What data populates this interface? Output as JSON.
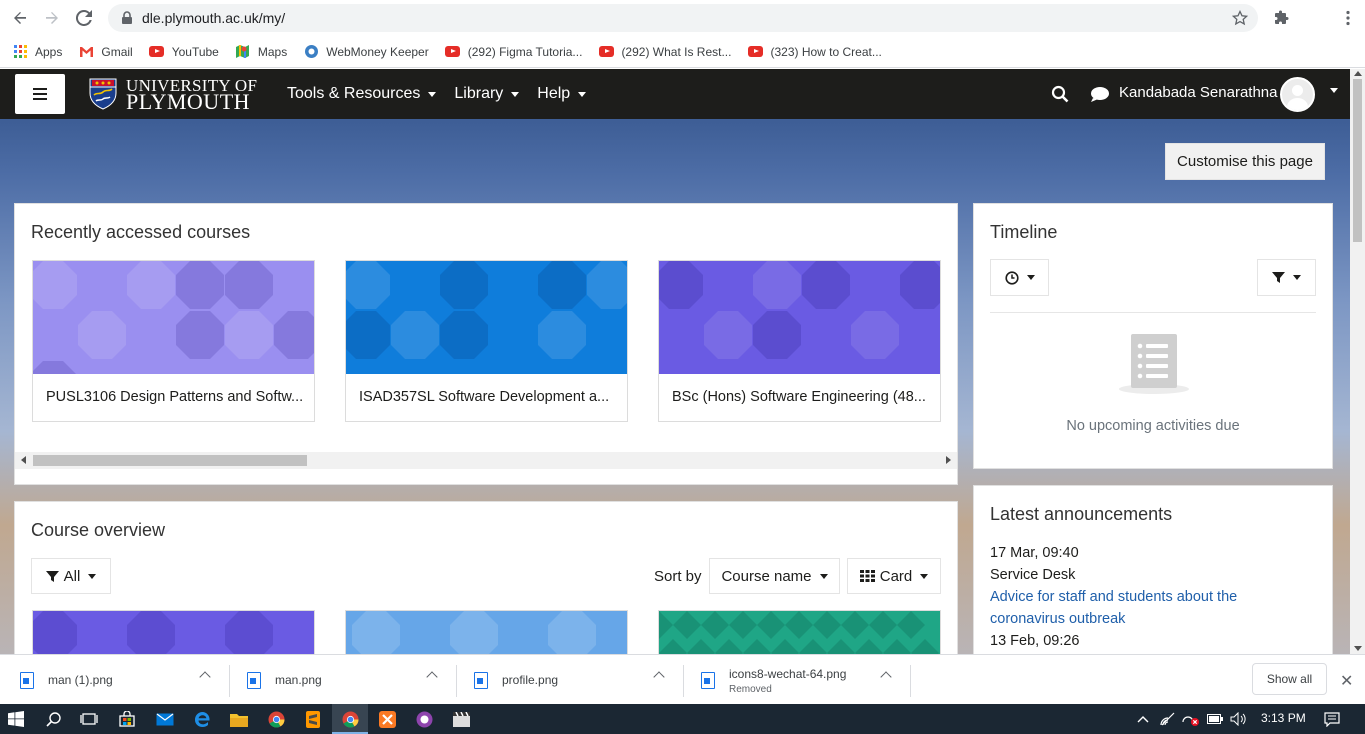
{
  "browser": {
    "url": "dle.plymouth.ac.uk/my/",
    "bookmarks": [
      {
        "label": "Apps",
        "icon": "apps-grid-icon"
      },
      {
        "label": "Gmail",
        "icon": "gmail-icon"
      },
      {
        "label": "YouTube",
        "icon": "youtube-icon"
      },
      {
        "label": "Maps",
        "icon": "maps-icon"
      },
      {
        "label": "WebMoney Keeper",
        "icon": "webmoney-icon"
      },
      {
        "label": "(292) Figma Tutoria...",
        "icon": "youtube-icon"
      },
      {
        "label": "(292) What Is Rest...",
        "icon": "youtube-icon"
      },
      {
        "label": "(323) How to Creat...",
        "icon": "youtube-icon"
      }
    ]
  },
  "navbar": {
    "logo_line1": "UNIVERSITY OF",
    "logo_line2": "PLYMOUTH",
    "menu": [
      "Tools & Resources",
      "Library",
      "Help"
    ],
    "user_name": "Kandabada Senarathna"
  },
  "page": {
    "customise_label": "Customise this page"
  },
  "recent": {
    "title": "Recently accessed courses",
    "courses": [
      {
        "name": "PUSL3106 Design Patterns and Softw...",
        "color": "#9a8ff0"
      },
      {
        "name": "ISAD357SL Software Development a...",
        "color": "#0f7ddb"
      },
      {
        "name": "BSc (Hons) Software Engineering (48...",
        "color": "#6a5be3"
      }
    ]
  },
  "timeline": {
    "title": "Timeline",
    "empty_text": "No upcoming activities due"
  },
  "overview": {
    "title": "Course overview",
    "filter_label": "All",
    "sort_label": "Sort by",
    "sort_value": "Course name",
    "view_value": "Card",
    "tiles": [
      "#6a5be3",
      "#66a6e8",
      "#1fa686"
    ]
  },
  "announcements": {
    "title": "Latest announcements",
    "items": [
      {
        "date": "17 Mar, 09:40",
        "author": "Service Desk",
        "link_line1": "Advice for staff and students about the",
        "link_line2": "coronavirus outbreak"
      },
      {
        "date": "13 Feb, 09:26"
      }
    ]
  },
  "downloads": {
    "items": [
      {
        "name": "man (1).png",
        "status": ""
      },
      {
        "name": "man.png",
        "status": ""
      },
      {
        "name": "profile.png",
        "status": ""
      },
      {
        "name": "icons8-wechat-64.png",
        "status": "Removed"
      }
    ],
    "show_all": "Show all"
  },
  "taskbar": {
    "time": "3:13 PM"
  }
}
